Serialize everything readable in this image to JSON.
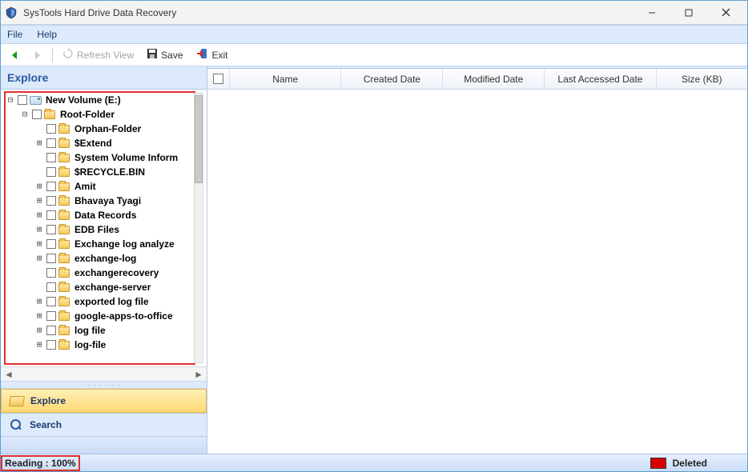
{
  "window": {
    "title": "SysTools Hard Drive Data Recovery"
  },
  "menu": {
    "file": "File",
    "help": "Help"
  },
  "toolbar": {
    "refresh": "Refresh View",
    "save": "Save",
    "exit": "Exit"
  },
  "explore": {
    "header": "Explore",
    "tabs": {
      "explore": "Explore",
      "search": "Search"
    }
  },
  "tree": [
    {
      "level": 0,
      "exp": "-",
      "bold": true,
      "icon": "drive",
      "label": "New Volume (E:)"
    },
    {
      "level": 1,
      "exp": "-",
      "bold": true,
      "icon": "folder",
      "label": "Root-Folder"
    },
    {
      "level": 2,
      "exp": "",
      "bold": true,
      "icon": "folder",
      "label": "Orphan-Folder"
    },
    {
      "level": 2,
      "exp": "+",
      "bold": true,
      "icon": "folder",
      "label": "$Extend"
    },
    {
      "level": 2,
      "exp": "",
      "bold": true,
      "icon": "folder",
      "label": "System Volume Inform"
    },
    {
      "level": 2,
      "exp": "",
      "bold": true,
      "icon": "folder",
      "label": "$RECYCLE.BIN"
    },
    {
      "level": 2,
      "exp": "+",
      "bold": true,
      "icon": "folder",
      "label": "Amit"
    },
    {
      "level": 2,
      "exp": "+",
      "bold": true,
      "icon": "folder",
      "label": "Bhavaya Tyagi"
    },
    {
      "level": 2,
      "exp": "+",
      "bold": true,
      "icon": "folder",
      "label": "Data Records"
    },
    {
      "level": 2,
      "exp": "+",
      "bold": true,
      "icon": "folder",
      "label": "EDB Files"
    },
    {
      "level": 2,
      "exp": "+",
      "bold": true,
      "icon": "folder",
      "label": "Exchange log analyze"
    },
    {
      "level": 2,
      "exp": "+",
      "bold": true,
      "icon": "folder",
      "label": "exchange-log"
    },
    {
      "level": 2,
      "exp": "",
      "bold": true,
      "icon": "folder",
      "label": "exchangerecovery"
    },
    {
      "level": 2,
      "exp": "",
      "bold": true,
      "icon": "folder",
      "label": "exchange-server"
    },
    {
      "level": 2,
      "exp": "+",
      "bold": true,
      "icon": "folder",
      "label": "exported log file"
    },
    {
      "level": 2,
      "exp": "+",
      "bold": true,
      "icon": "folder",
      "label": "google-apps-to-office"
    },
    {
      "level": 2,
      "exp": "+",
      "bold": true,
      "icon": "folder",
      "label": "log file"
    },
    {
      "level": 2,
      "exp": "+",
      "bold": true,
      "icon": "folder",
      "label": "log-file"
    }
  ],
  "columns": {
    "name": "Name",
    "created": "Created Date",
    "modified": "Modified Date",
    "accessed": "Last Accessed Date",
    "size": "Size (KB)"
  },
  "status": {
    "reading": "Reading : 100%",
    "deleted": "Deleted"
  }
}
